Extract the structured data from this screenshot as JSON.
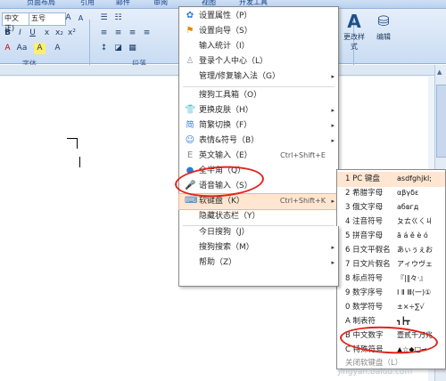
{
  "ribbon": {
    "tabs": [
      "页面布局",
      "引用",
      "邮件",
      "审阅",
      "视图",
      "开发工具"
    ],
    "font_name": "中文正)",
    "font_size": "五号",
    "group_font": "字体",
    "group_paragraph": "段落",
    "change_styles": "更改样式",
    "edit": "编辑"
  },
  "menu": {
    "items": [
      {
        "icon": "✿",
        "label": "设置属性（P）",
        "shortcut": "",
        "arrow": ""
      },
      {
        "icon": "⚑",
        "label": "设置向导（S）",
        "shortcut": "",
        "arrow": ""
      },
      {
        "icon": "",
        "label": "输入统计（I）",
        "shortcut": "",
        "arrow": ""
      },
      {
        "icon": "♙",
        "label": "登录个人中心（L）",
        "shortcut": "",
        "arrow": ""
      },
      {
        "icon": "",
        "label": "管理/修复输入法（G）",
        "shortcut": "",
        "arrow": "▸"
      },
      {
        "icon": "",
        "label": "搜狗工具箱（O）",
        "shortcut": "",
        "arrow": ""
      },
      {
        "icon": "👕",
        "label": "更换皮肤（H）",
        "shortcut": "",
        "arrow": "▸"
      },
      {
        "icon": "简",
        "label": "简繁切换（F）",
        "shortcut": "",
        "arrow": "▸"
      },
      {
        "icon": "☺",
        "label": "表情&符号（B）",
        "shortcut": "",
        "arrow": "▸"
      },
      {
        "icon": "E",
        "label": "英文输入（E）",
        "shortcut": "Ctrl+Shift+E",
        "arrow": ""
      },
      {
        "icon": "●",
        "label": "全半角（Q）",
        "shortcut": "",
        "arrow": ""
      },
      {
        "icon": "🎤",
        "label": "语音输入（S）",
        "shortcut": "",
        "arrow": ""
      },
      {
        "icon": "⌨",
        "label": "软键盘（K）",
        "shortcut": "Ctrl+Shift+K",
        "arrow": "▸"
      },
      {
        "icon": "",
        "label": "隐藏状态栏（Y）",
        "shortcut": "",
        "arrow": ""
      },
      {
        "icon": "",
        "label": "今日搜狗（J）",
        "shortcut": "",
        "arrow": ""
      },
      {
        "icon": "",
        "label": "搜狗搜索（M）",
        "shortcut": "",
        "arrow": "▸"
      },
      {
        "icon": "",
        "label": "帮助（Z）",
        "shortcut": "",
        "arrow": "▸"
      }
    ]
  },
  "submenu": {
    "items": [
      {
        "label": "1 PC 键盘",
        "preview": "asdfghjkl;"
      },
      {
        "label": "2 希腊字母",
        "preview": "αβγδε"
      },
      {
        "label": "3 俄文字母",
        "preview": "абвгд"
      },
      {
        "label": "4 注音符号",
        "preview": "ㄆㄊㄍㄑㄐ"
      },
      {
        "label": "5 拼音字母",
        "preview": "ā á ě è ó"
      },
      {
        "label": "6 日文平假名",
        "preview": "あぃぅぇお"
      },
      {
        "label": "7 日文片假名",
        "preview": "アィウヴェ"
      },
      {
        "label": "8 标点符号",
        "preview": "『|‖々·』"
      },
      {
        "label": "9 数字序号",
        "preview": "Ⅰ Ⅱ Ⅲ(一)①"
      },
      {
        "label": "0 数学符号",
        "preview": "±×÷∑√"
      },
      {
        "label": "A 制表符",
        "preview": "┓┣┳"
      },
      {
        "label": "B 中文数字",
        "preview": "壹贰千万兆"
      },
      {
        "label": "C 特殊符号",
        "preview": "▲☆◆□→"
      },
      {
        "label": "关闭软键盘（L）",
        "preview": ""
      }
    ]
  },
  "watermark": "Jingyan.baidu.com"
}
